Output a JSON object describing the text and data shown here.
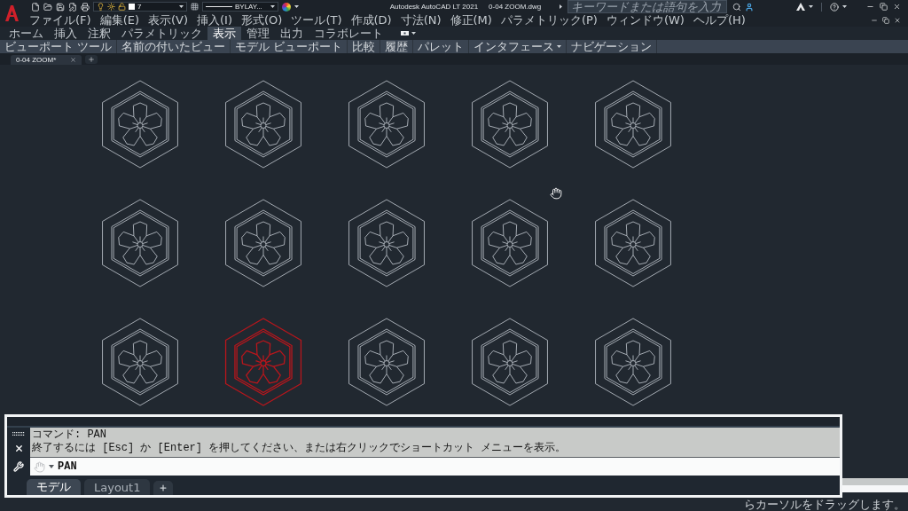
{
  "quick_access": {
    "layer": "7",
    "linetype": "BYLAY..."
  },
  "title": {
    "app": "Autodesk AutoCAD LT 2021",
    "file": "0-04 ZOOM.dwg"
  },
  "search": {
    "placeholder": "キーワードまたは語句を入力"
  },
  "menu": [
    "ファイル(F)",
    "編集(E)",
    "表示(V)",
    "挿入(I)",
    "形式(O)",
    "ツール(T)",
    "作成(D)",
    "寸法(N)",
    "修正(M)",
    "パラメトリック(P)",
    "ウィンドウ(W)",
    "ヘルプ(H)"
  ],
  "ribbon_tabs": [
    {
      "label": "ホーム",
      "selected": false
    },
    {
      "label": "挿入",
      "selected": false
    },
    {
      "label": "注釈",
      "selected": false
    },
    {
      "label": "パラメトリック",
      "selected": false
    },
    {
      "label": "表示",
      "selected": true
    },
    {
      "label": "管理",
      "selected": false
    },
    {
      "label": "出力",
      "selected": false
    },
    {
      "label": "コラボレート",
      "selected": false
    }
  ],
  "ribbon_panels": [
    {
      "label": "ビューポート ツール",
      "expandable": false
    },
    {
      "label": "名前の付いたビュー",
      "expandable": false
    },
    {
      "label": "モデル ビューポート",
      "expandable": false
    },
    {
      "label": "比較",
      "expandable": false
    },
    {
      "label": "履歴",
      "expandable": false
    },
    {
      "label": "パレット",
      "expandable": false
    },
    {
      "label": "インタフェース",
      "expandable": true
    },
    {
      "label": "ナビゲーション",
      "expandable": false
    }
  ],
  "file_tabs": [
    {
      "label": "0-04 ZOOM*",
      "selected": true
    }
  ],
  "symbols": [
    {
      "selected": false
    },
    {
      "selected": false
    },
    {
      "selected": false
    },
    {
      "selected": false
    },
    {
      "selected": false
    },
    {
      "selected": false
    },
    {
      "selected": false
    },
    {
      "selected": false
    },
    {
      "selected": false
    },
    {
      "selected": false
    },
    {
      "selected": false
    },
    {
      "selected": true
    },
    {
      "selected": false
    },
    {
      "selected": false
    },
    {
      "selected": false
    }
  ],
  "command_window": {
    "history": [
      "コマンド: PAN",
      "終了するには [Esc] か [Enter] を押してください、または右クリックでショートカット メニューを表示。"
    ],
    "input": "PAN",
    "layout_tabs": [
      {
        "label": "モデル",
        "selected": true
      },
      {
        "label": "Layout1",
        "selected": false
      }
    ]
  },
  "status_text": "らカーソルをドラッグします。"
}
